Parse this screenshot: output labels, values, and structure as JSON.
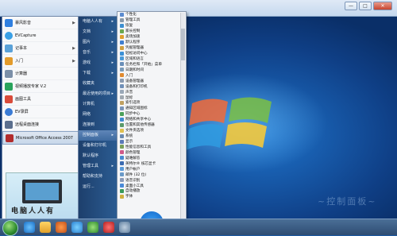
{
  "left_menu": {
    "items": [
      {
        "label": "暴风影音",
        "has_arrow": true,
        "color": "#2f7fe0"
      },
      {
        "label": "EVCapture",
        "has_arrow": false,
        "color": "#3aa0e6"
      },
      {
        "label": "记事本",
        "has_arrow": true,
        "color": "#5aa1d8"
      },
      {
        "label": "入门",
        "has_arrow": true,
        "color": "#e39b2b"
      },
      {
        "label": "计算器",
        "has_arrow": false,
        "color": "#7b8fa8"
      },
      {
        "label": "视频播放专家 V.2",
        "has_arrow": false,
        "color": "#2aa35c"
      },
      {
        "label": "画图工具",
        "has_arrow": false,
        "color": "#d94b3a"
      },
      {
        "label": "EV录屏",
        "has_arrow": false,
        "color": "#3a7bd5"
      },
      {
        "label": "远程桌面连接",
        "has_arrow": false,
        "color": "#5b6f8e"
      },
      {
        "label": "Microsoft Office Access 2007",
        "has_arrow": false,
        "color": "#b22c2c",
        "selected": true
      }
    ],
    "photo_caption": "电脑人人有"
  },
  "right_menu": {
    "links": [
      {
        "label": "电脑人人有",
        "arrow": true
      },
      {
        "label": "文档",
        "arrow": true
      },
      {
        "label": "图片",
        "arrow": true
      },
      {
        "label": "音乐",
        "arrow": true
      },
      {
        "label": "游戏",
        "arrow": true
      },
      {
        "label": "下载",
        "arrow": true
      },
      {
        "label": "收藏夹",
        "arrow": false
      },
      {
        "label": "最近使用的项目",
        "arrow": true
      },
      {
        "label": "计算机",
        "arrow": false
      },
      {
        "label": "网络",
        "arrow": false
      },
      {
        "label": "连接到",
        "arrow": false
      },
      {
        "label": "控制面板",
        "arrow": true,
        "highlight": true
      },
      {
        "label": "设备和打印机",
        "arrow": false
      },
      {
        "label": "默认程序",
        "arrow": false
      },
      {
        "label": "管理工具",
        "arrow": true
      },
      {
        "label": "帮助和支持",
        "arrow": false
      },
      {
        "label": "运行...",
        "arrow": false
      }
    ]
  },
  "control_panel_submenu": {
    "items": [
      {
        "label": "个性化",
        "color": "#5b8bd0"
      },
      {
        "label": "管理工具",
        "color": "#8899aa"
      },
      {
        "label": "恢复",
        "color": "#3d8fd1"
      },
      {
        "label": "家长控制",
        "color": "#6aa84f"
      },
      {
        "label": "卖场加速",
        "color": "#e0a030"
      },
      {
        "label": "默认程序",
        "color": "#3f7fd0"
      },
      {
        "label": "凭据管理器",
        "color": "#d0a040"
      },
      {
        "label": "轻松访问中心",
        "color": "#3a90d6"
      },
      {
        "label": "区域和语言",
        "color": "#4a9ad8"
      },
      {
        "label": "任务栏和「开始」菜单",
        "color": "#6a8fb8"
      },
      {
        "label": "日期和时间",
        "color": "#7a9ab8"
      },
      {
        "label": "入门",
        "color": "#e08a30"
      },
      {
        "label": "设备管理器",
        "color": "#8a9ab0"
      },
      {
        "label": "设备和打印机",
        "color": "#7090b8"
      },
      {
        "label": "声音",
        "color": "#9aa8b8"
      },
      {
        "label": "鼠标",
        "color": "#a0a8b0"
      },
      {
        "label": "索引选项",
        "color": "#c0a060"
      },
      {
        "label": "通知区域图标",
        "color": "#7a94b8"
      },
      {
        "label": "同步中心",
        "color": "#4aa05a"
      },
      {
        "label": "网络和共享中心",
        "color": "#3f8ad0"
      },
      {
        "label": "位置和其他传感器",
        "color": "#5a9a6a"
      },
      {
        "label": "文件夹选项",
        "color": "#e0c050"
      },
      {
        "label": "系统",
        "color": "#6a8ab0"
      },
      {
        "label": "显示",
        "color": "#5a7ab8"
      },
      {
        "label": "性能信息和工具",
        "color": "#7aa05a"
      },
      {
        "label": "颜色管理",
        "color": "#d05a8a"
      },
      {
        "label": "疑难解答",
        "color": "#4a8ad0"
      },
      {
        "label": "英特尔® 核芯显卡",
        "color": "#3a6ab0"
      },
      {
        "label": "用户帐户",
        "color": "#5a9ad8"
      },
      {
        "label": "邮件 (32 位)",
        "color": "#6a9ac8"
      },
      {
        "label": "语音识别",
        "color": "#8a9ab8"
      },
      {
        "label": "桌面小工具",
        "color": "#4a8ad8"
      },
      {
        "label": "自动播放",
        "color": "#3a9a5a"
      },
      {
        "label": "字体",
        "color": "#d0b040"
      }
    ]
  },
  "desktop": {
    "watermark": "~控制面板~"
  },
  "window": {
    "min": "—",
    "max": "□",
    "close": "✕"
  }
}
